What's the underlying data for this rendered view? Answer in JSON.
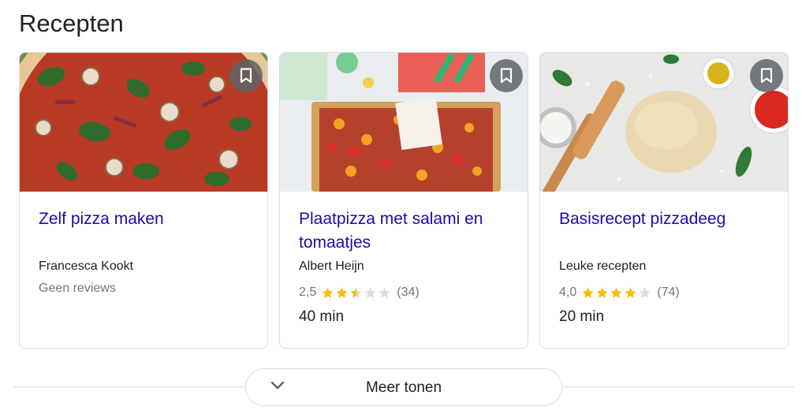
{
  "section": {
    "title": "Recepten"
  },
  "cards": [
    {
      "title": "Zelf pizza maken",
      "source": "Francesca Kookt",
      "reviews": "Geen reviews"
    },
    {
      "title": "Plaatpizza met salami en tomaatjes",
      "source": "Albert Heijn",
      "rating": "2,5",
      "rating_value": 2.5,
      "count": "(34)",
      "time": "40 min"
    },
    {
      "title": "Basisrecept pizzadeeg",
      "source": "Leuke recepten",
      "rating": "4,0",
      "rating_value": 4.0,
      "count": "(74)",
      "time": "20 min"
    }
  ],
  "more": {
    "label": "Meer tonen"
  },
  "icons": {
    "bookmark": "bookmark-icon",
    "chevron": "chevron-down-icon",
    "star": "star-icon"
  },
  "colors": {
    "link": "#1a0dab",
    "star_filled": "#fbbc04",
    "star_empty": "#dadce0",
    "bookmark_bg": "#5f6368"
  }
}
